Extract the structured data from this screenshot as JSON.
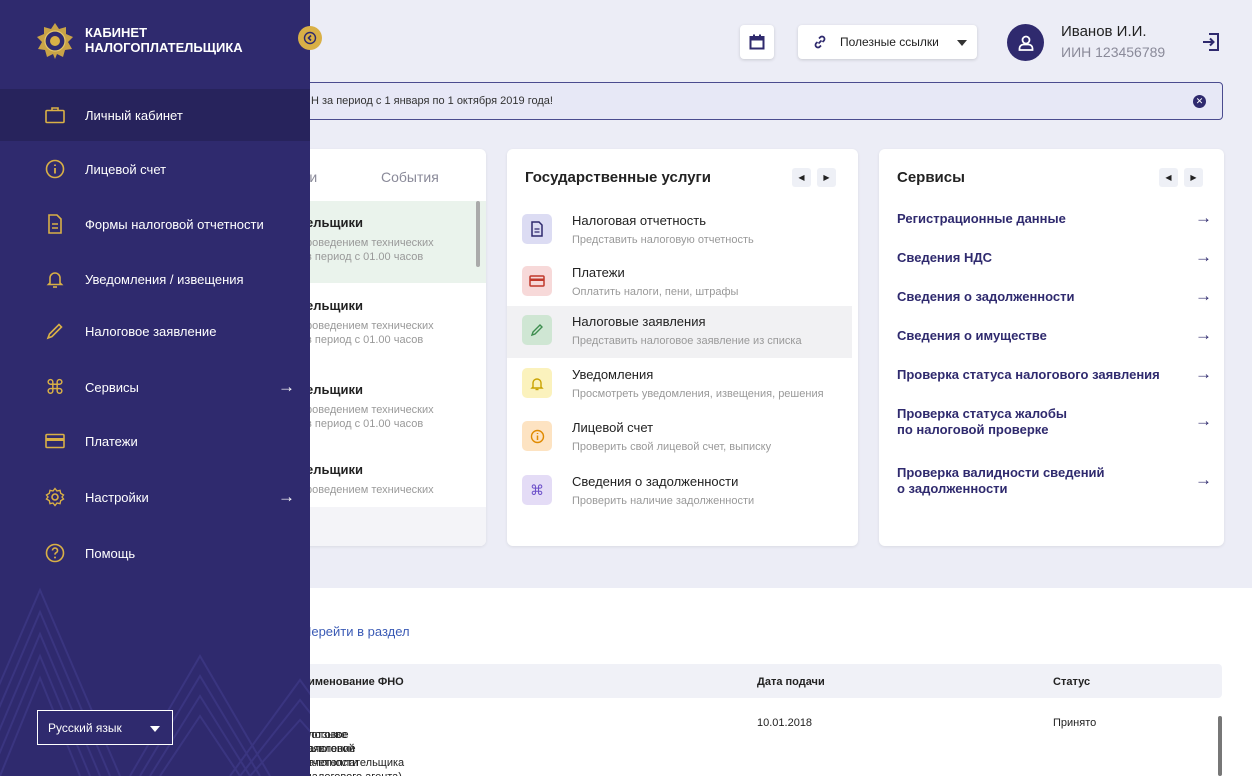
{
  "header": {
    "links_label": "Полезные ссылки",
    "user_name": "Иванов И.И.",
    "user_inn": "ИИН 123456789"
  },
  "banner": {
    "text": "Н за период с 1 января по 1 октября 2019 года!"
  },
  "news": {
    "tabs": [
      "сти",
      "События"
    ],
    "items": [
      {
        "title": "ельщики",
        "desc1": "роведением технических",
        "desc2": "в период с 01.00 часов"
      },
      {
        "title": "ельщики",
        "desc1": "роведением технических",
        "desc2": "в период с 01.00 часов"
      },
      {
        "title": "ельщики",
        "desc1": "роведением технических",
        "desc2": "в период с 01.00 часов"
      },
      {
        "title": "ельщики",
        "desc1": "роведением технических",
        "desc2": ""
      }
    ]
  },
  "gov_services": {
    "title": "Государственные услуги",
    "items": [
      {
        "title": "Налоговая отчетность",
        "sub": "Представить налоговую отчетность",
        "icon": "document-icon"
      },
      {
        "title": "Платежи",
        "sub": "Оплатить налоги, пени, штрафы",
        "icon": "card-icon"
      },
      {
        "title": "Налоговые заявления",
        "sub": "Представить налоговое заявление из списка",
        "icon": "pencil-icon"
      },
      {
        "title": "Уведомления",
        "sub": "Просмотреть уведомления, извещения, решения",
        "icon": "bell-icon"
      },
      {
        "title": "Лицевой счет",
        "sub": "Проверить свой лицевой счет, выписку",
        "icon": "info-icon"
      },
      {
        "title": "Сведения о задолженности",
        "sub": "Проверить наличие задолженности",
        "icon": "command-icon"
      }
    ]
  },
  "services": {
    "title": "Сервисы",
    "items": [
      {
        "l1": "Регистрационные данные",
        "l2": ""
      },
      {
        "l1": "Сведения НДС",
        "l2": ""
      },
      {
        "l1": "Сведения о задолженности",
        "l2": ""
      },
      {
        "l1": "Сведения о имуществе",
        "l2": ""
      },
      {
        "l1": "Проверка статуса налогового заявления",
        "l2": ""
      },
      {
        "l1": "Проверка статуса жалобы",
        "l2": "по налоговой проверке"
      },
      {
        "l1": "Проверка валидности сведений",
        "l2": "о задолженности"
      }
    ]
  },
  "bottom": {
    "goto": "Перейти в раздел",
    "col_name": "аименование  ФНО",
    "col_date": "Дата подачи",
    "col_status": "Статус",
    "row_name1": "алоговое заявление налогоплательщика (налогового агента)",
    "row_name2": "б отзыве налоговой отчетности",
    "row_date": "10.01.2018",
    "row_status": "Принято"
  },
  "sidebar": {
    "brand1": "КАБИНЕТ",
    "brand2": "НАЛОГОПЛАТЕЛЬЩИКА",
    "items": [
      {
        "label": "Личный кабинет",
        "icon": "briefcase-icon"
      },
      {
        "label": "Лицевой счет",
        "icon": "info-icon"
      },
      {
        "label": "Формы налоговой отчетности",
        "icon": "document-icon"
      },
      {
        "label": "Уведомления / извещения",
        "icon": "bell-icon"
      },
      {
        "label": "Налоговое заявление",
        "icon": "pencil-icon"
      },
      {
        "label": "Сервисы",
        "icon": "command-icon"
      },
      {
        "label": "Платежи",
        "icon": "card-icon"
      },
      {
        "label": "Настройки",
        "icon": "gear-icon"
      },
      {
        "label": "Помощь",
        "icon": "help-icon"
      }
    ],
    "language": "Русский язык"
  },
  "colors": {
    "primary": "#2f2a6e",
    "accent": "#d9b046",
    "background": "#ecedf6"
  }
}
